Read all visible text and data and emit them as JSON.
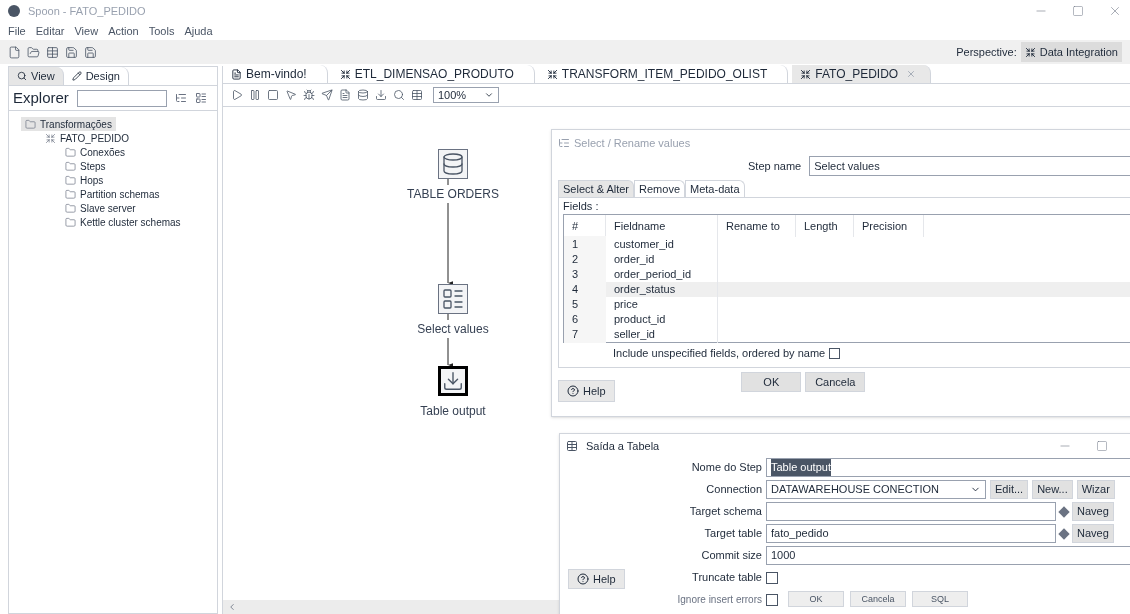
{
  "window": {
    "title": "Spoon - FATO_PEDIDO"
  },
  "menu": [
    "File",
    "Editar",
    "View",
    "Action",
    "Tools",
    "Ajuda"
  ],
  "perspective": {
    "label": "Perspective:",
    "value": "Data Integration"
  },
  "left_tabs": [
    {
      "label": "View",
      "selected": true
    },
    {
      "label": "Design",
      "selected": false
    }
  ],
  "explorer": {
    "label": "Explorer"
  },
  "tree": [
    {
      "label": "Transformações",
      "kind": "folder",
      "selected": true,
      "children": [
        {
          "label": "FATO_PEDIDO",
          "kind": "transformation",
          "selected": false,
          "children": [
            {
              "label": "Conexões",
              "kind": "folder",
              "selected": false
            },
            {
              "label": "Steps",
              "kind": "folder",
              "selected": false
            },
            {
              "label": "Hops",
              "kind": "folder",
              "selected": false
            },
            {
              "label": "Partition schemas",
              "kind": "folder",
              "selected": false
            },
            {
              "label": "Slave server",
              "kind": "folder",
              "selected": false
            },
            {
              "label": "Kettle cluster schemas",
              "kind": "folder",
              "selected": false
            }
          ]
        }
      ]
    }
  ],
  "tabs": [
    {
      "label": "Bem-vindo!",
      "kind": "welcome",
      "selected": false
    },
    {
      "label": "ETL_DIMENSAO_PRODUTO",
      "kind": "transformation",
      "selected": false
    },
    {
      "label": "TRANSFORM_ITEM_PEDIDO_OLIST",
      "kind": "transformation",
      "selected": false
    },
    {
      "label": "FATO_PEDIDO",
      "kind": "transformation",
      "selected": true
    }
  ],
  "zoom": "100%",
  "nodes": [
    {
      "label": "TABLE ORDERS",
      "kind": "table-input",
      "selected": false
    },
    {
      "label": "Select values",
      "kind": "select",
      "selected": false
    },
    {
      "label": "Table output",
      "kind": "table-output",
      "selected": true
    }
  ],
  "select_dialog": {
    "title": "Select / Rename values",
    "step_label": "Step name",
    "step_value": "Select values",
    "tabs": [
      {
        "label": "Select & Alter",
        "selected": true
      },
      {
        "label": "Remove",
        "selected": false
      },
      {
        "label": "Meta-data",
        "selected": false
      }
    ],
    "fields_label": "Fields :",
    "columns": [
      "#",
      "Fieldname",
      "Rename to",
      "Length",
      "Precision"
    ],
    "rows": [
      {
        "n": "1",
        "field": "customer_id",
        "selected": false
      },
      {
        "n": "2",
        "field": "order_id",
        "selected": false
      },
      {
        "n": "3",
        "field": "order_period_id",
        "selected": false
      },
      {
        "n": "4",
        "field": "order_status",
        "selected": true
      },
      {
        "n": "5",
        "field": "price",
        "selected": false
      },
      {
        "n": "6",
        "field": "product_id",
        "selected": false
      },
      {
        "n": "7",
        "field": "seller_id",
        "selected": false
      }
    ],
    "include": {
      "label": "Include unspecified fields, ordered by name",
      "checked": false
    },
    "buttons": [
      "OK",
      "Cancela"
    ],
    "help": "Help"
  },
  "output_dialog": {
    "title": "Saída a Tabela",
    "rows": [
      {
        "kind": "text",
        "label": "Nome do Step",
        "value": "Table output",
        "highlighted": true
      },
      {
        "kind": "select",
        "label": "Connection",
        "value": "DATAWAREHOUSE CONECTION",
        "buttons": [
          "Edit...",
          "New...",
          "Wizar"
        ]
      },
      {
        "kind": "variable",
        "label": "Target schema",
        "button": "Naveg"
      },
      {
        "kind": "variable",
        "label": "Target table",
        "value": "fato_pedido",
        "button": "Naveg"
      },
      {
        "kind": "text",
        "label": "Commit size",
        "value": "1000",
        "highlighted": false
      },
      {
        "kind": "checkbox",
        "label": "Truncate table",
        "checked": false
      },
      {
        "kind": "checkbox",
        "label": "Ignore insert errors",
        "checked": false
      }
    ],
    "buttons": [
      "OK",
      "Cancela",
      "SQL"
    ],
    "help": "Help"
  }
}
